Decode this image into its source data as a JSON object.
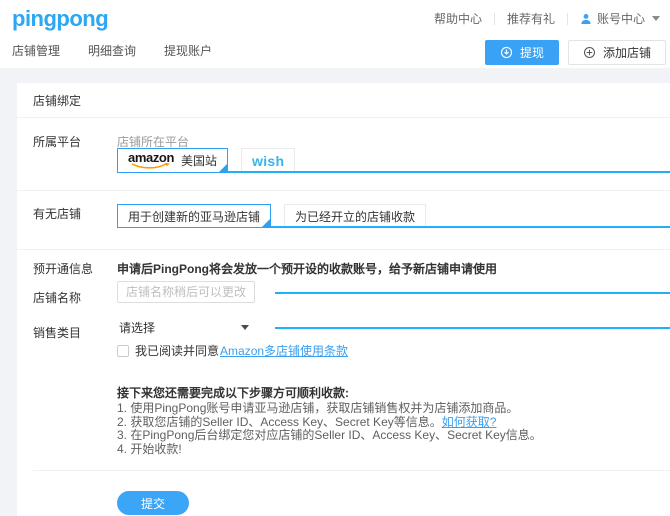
{
  "header": {
    "logo": "pingpong",
    "utility": [
      {
        "label": "帮助中心"
      },
      {
        "label": "推荐有礼"
      },
      {
        "label": "账号中心"
      }
    ],
    "nav": [
      "店铺管理",
      "明细查询",
      "提现账户"
    ],
    "withdraw_label": "提现",
    "add_store_label": "添加店铺"
  },
  "form": {
    "title": "店铺绑定",
    "platform": {
      "label": "所属平台",
      "helper": "店铺所在平台",
      "amazon_tab": {
        "logo": "amazon",
        "region": "美国站"
      },
      "wish_tab": {
        "logo": "wish"
      }
    },
    "shop_status": {
      "label": "有无店铺",
      "tabs": [
        "用于创建新的亚马逊店铺",
        "为已经开立的店铺收款"
      ]
    },
    "preopen": {
      "label": "预开通信息",
      "description": "申请后PingPong将会发放一个预开设的收款账号，给予新店铺申请使用"
    },
    "shop_name": {
      "label": "店铺名称",
      "value": "",
      "placeholder": "店铺名称稍后可以更改"
    },
    "category": {
      "label": "销售类目",
      "value": "请选择"
    },
    "agreement": {
      "text": "我已阅读并同意",
      "link": "Amazon多店铺使用条款"
    },
    "steps_title": "接下来您还需要完成以下步骤方可顺利收款:",
    "steps": [
      {
        "text": "1. 使用PingPong账号申请亚马逊店铺，获取店铺销售权并为店铺添加商品。"
      },
      {
        "text": "2. 获取您店铺的Seller ID、Access Key、Secret Key等信息。",
        "link": "如何获取?"
      },
      {
        "text": "3. 在PingPong后台绑定您对应店铺的Seller ID、Access Key、Secret Key信息。"
      },
      {
        "text": "4. 开始收款!"
      }
    ],
    "submit_label": "提交"
  },
  "icons": {
    "user": "user-icon",
    "caret": "caret-down-icon",
    "withdraw": "withdraw-circle-arrow-icon",
    "add": "plus-circle-icon",
    "amazon_smile": "amazon-smile-icon",
    "checkbox": "checkbox-unchecked",
    "select_caret": "select-caret-down-icon"
  },
  "colors": {
    "accent_blue": "#3aa2f5",
    "line_blue": "#1fb1f8",
    "link_blue": "#3a9ff0",
    "logo_blue": "#2ba7f3",
    "amazon_orange": "#ff9900",
    "wish_blue": "#35b5ec",
    "page_bg": "#f1f3f6",
    "card_bg": "#ffffff"
  }
}
